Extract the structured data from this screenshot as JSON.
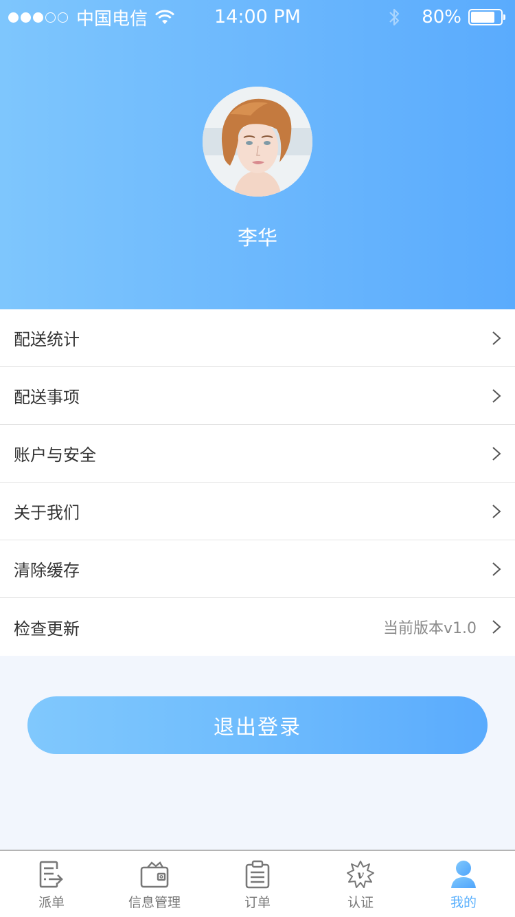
{
  "status_bar": {
    "signal_full": 3,
    "signal_total": 5,
    "carrier": "中国电信",
    "time": "14:00 PM",
    "battery_percent_text": "80%",
    "battery_level": 0.8
  },
  "profile": {
    "avatar_alt": "用户头像",
    "name": "李华"
  },
  "menu": {
    "items": [
      {
        "label": "配送统计",
        "value": ""
      },
      {
        "label": "配送事项",
        "value": ""
      },
      {
        "label": "账户与安全",
        "value": ""
      },
      {
        "label": "关于我们",
        "value": ""
      },
      {
        "label": "清除缓存",
        "value": ""
      },
      {
        "label": "检查更新",
        "value": "当前版本v1.0"
      }
    ]
  },
  "logout_label": "退出登录",
  "tabbar": {
    "active_index": 4,
    "active_color": "#5ab0fd",
    "inactive_color": "#777777",
    "tabs": [
      {
        "label": "派单",
        "icon": "dispatch-icon"
      },
      {
        "label": "信息管理",
        "icon": "wallet-icon"
      },
      {
        "label": "订单",
        "icon": "clipboard-icon"
      },
      {
        "label": "认证",
        "icon": "verified-badge-icon"
      },
      {
        "label": "我的",
        "icon": "user-icon"
      }
    ]
  },
  "colors": {
    "header_gradient_start": "#7ec6fd",
    "header_gradient_end": "#5aabfd",
    "page_background": "#f2f6fd"
  }
}
